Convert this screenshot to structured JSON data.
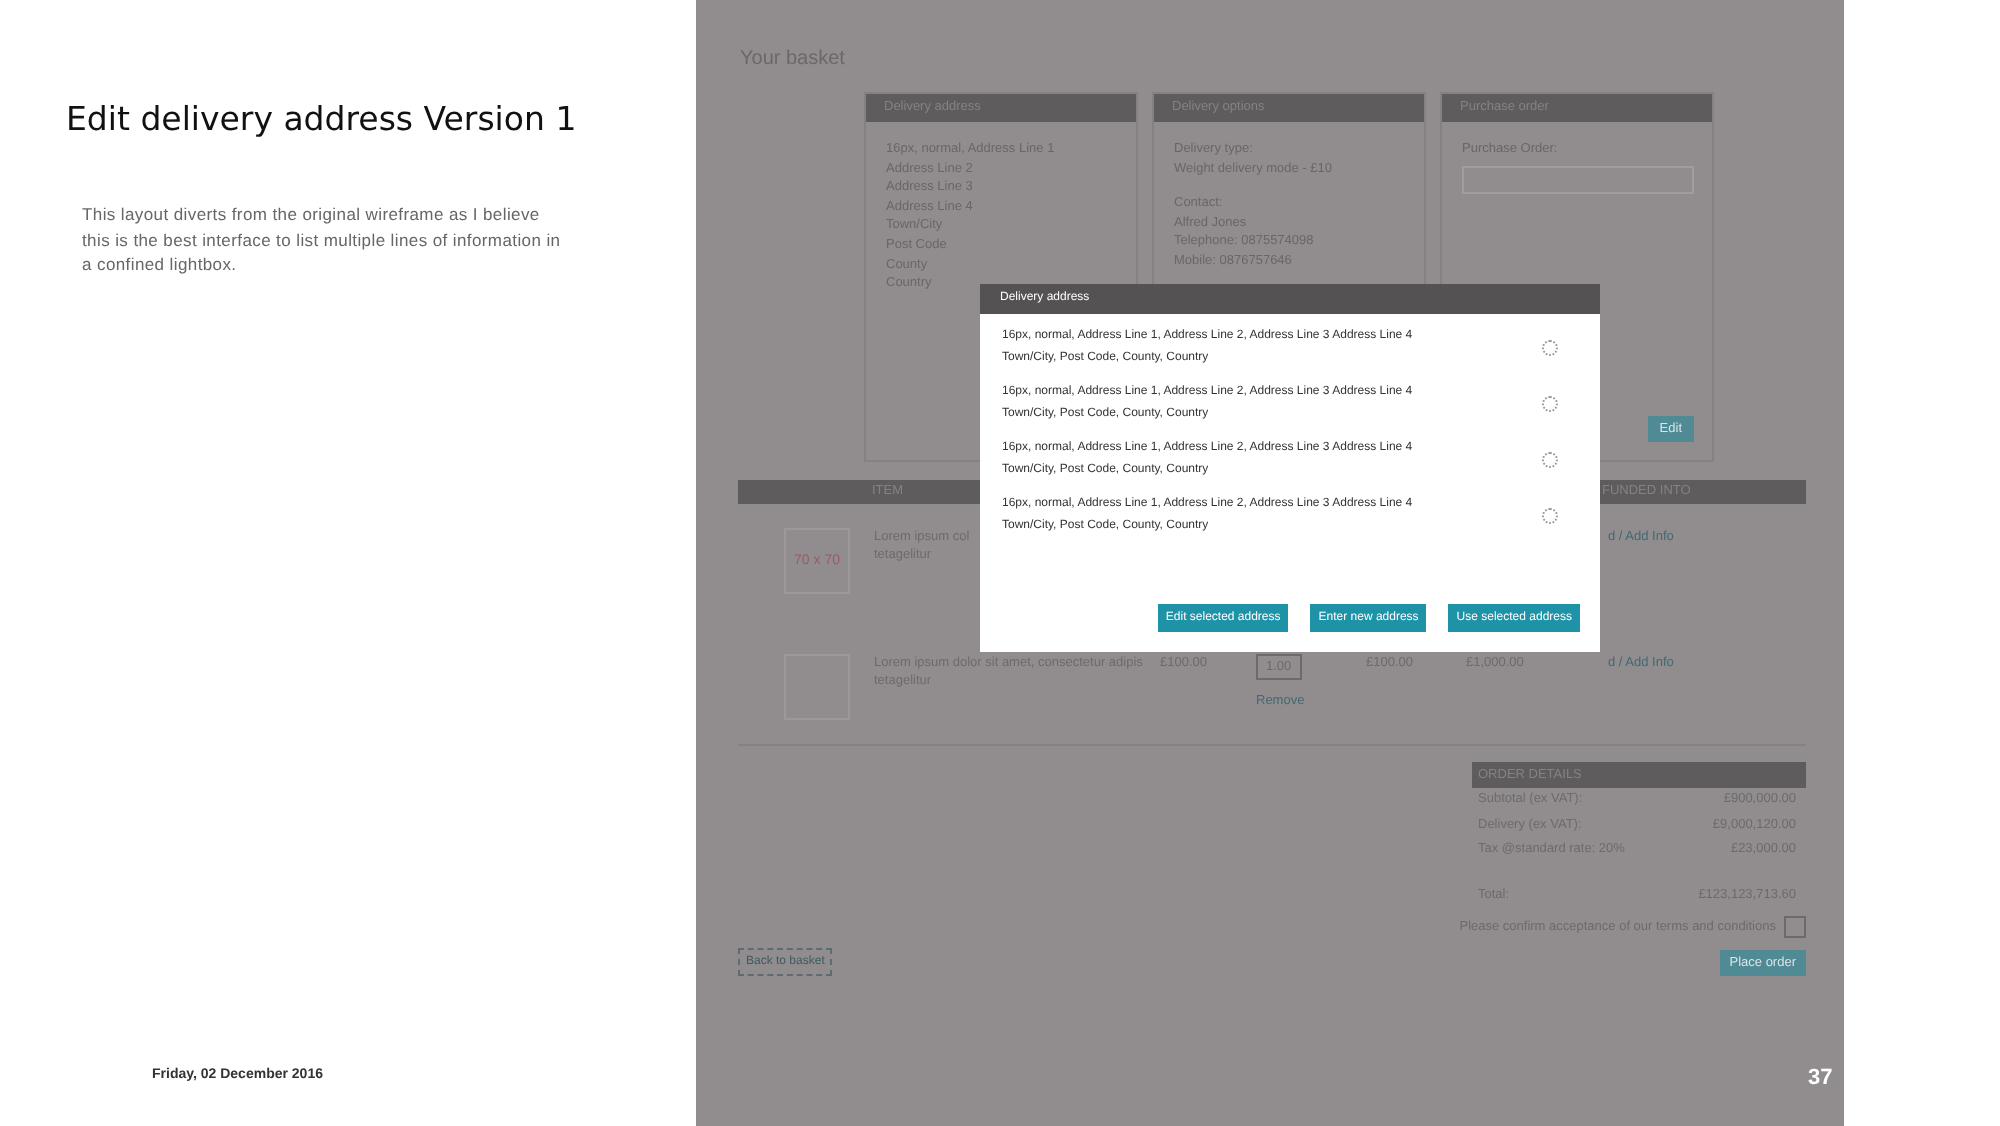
{
  "slide": {
    "title": "Edit delivery address Version 1",
    "description": "This layout diverts from the original wireframe as I believe this is the best interface to list multiple lines of information in a confined lightbox.",
    "date": "Friday, 02 December 2016",
    "page_number": "37"
  },
  "wireframe": {
    "heading": "Your basket",
    "panels": [
      {
        "kind": "lines",
        "title": "Delivery address",
        "groups": [
          [
            "16px, normal, Address Line 1",
            "Address Line 2",
            "Address Line 3",
            "Address Line 4",
            "Town/City",
            "Post Code",
            "County",
            "Country"
          ]
        ]
      },
      {
        "kind": "lines",
        "title": "Delivery options",
        "groups": [
          [
            "Delivery type:",
            "Weight delivery mode - £10"
          ],
          [
            "Contact:",
            "Alfred Jones",
            "Telephone: 0875574098",
            "Mobile: 0876757646"
          ]
        ]
      },
      {
        "kind": "form",
        "title": "Purchase order",
        "field_label": "Purchase Order:",
        "button": "Edit"
      }
    ],
    "items_table": {
      "columns": [
        {
          "label": "ITEM"
        },
        {
          "label": "FUNDED INTO"
        }
      ],
      "rows": [
        {
          "image_label": "70 x 70",
          "description": "Lorem ipsum col",
          "description_2": "tetagelitur",
          "link": "d / Add Info"
        },
        {
          "image_label": "",
          "description": "Lorem ipsum dolor sit amet, consectetur adipis",
          "description_2": "tetagelitur",
          "price": "£100.00",
          "quantity": "1.00",
          "remove": "Remove",
          "total": "£100.00",
          "funded": "£1,000.00",
          "link": "d / Add Info"
        }
      ]
    },
    "order_details": {
      "title": "ORDER DETAILS",
      "rows": [
        {
          "label": "Subtotal (ex VAT):",
          "value": "£900,000.00",
          "kind": "line"
        },
        {
          "label": "Delivery (ex VAT):",
          "value": "£9,000,120.00",
          "kind": "line"
        },
        {
          "label": "Tax @standard rate: 20%",
          "value": "£23,000.00",
          "kind": "line"
        },
        {
          "label": "Total:",
          "value": "£123,123,713.60",
          "kind": "total"
        }
      ]
    },
    "terms": {
      "label": "Please confirm acceptance of our terms and conditions",
      "checked": false
    },
    "back_button": "Back to basket",
    "place_order_button": "Place order",
    "modal": {
      "title": "Delivery address",
      "options": [
        {
          "line_1": "16px, normal, Address Line 1, Address Line 2, Address Line 3 Address Line 4",
          "line_2": "Town/City, Post Code, County, Country",
          "selected": false
        },
        {
          "line_1": "16px, normal, Address Line 1, Address Line 2, Address Line 3 Address Line 4",
          "line_2": "Town/City, Post Code, County, Country",
          "selected": false
        },
        {
          "line_1": "16px, normal, Address Line 1, Address Line 2, Address Line 3 Address Line 4",
          "line_2": "Town/City, Post Code, County, Country",
          "selected": false
        },
        {
          "line_1": "16px, normal, Address Line 1, Address Line 2, Address Line 3 Address Line 4",
          "line_2": "Town/City, Post Code, County, Country",
          "selected": false
        }
      ],
      "buttons": [
        "Edit selected address",
        "Enter new address",
        "Use selected address"
      ]
    }
  }
}
